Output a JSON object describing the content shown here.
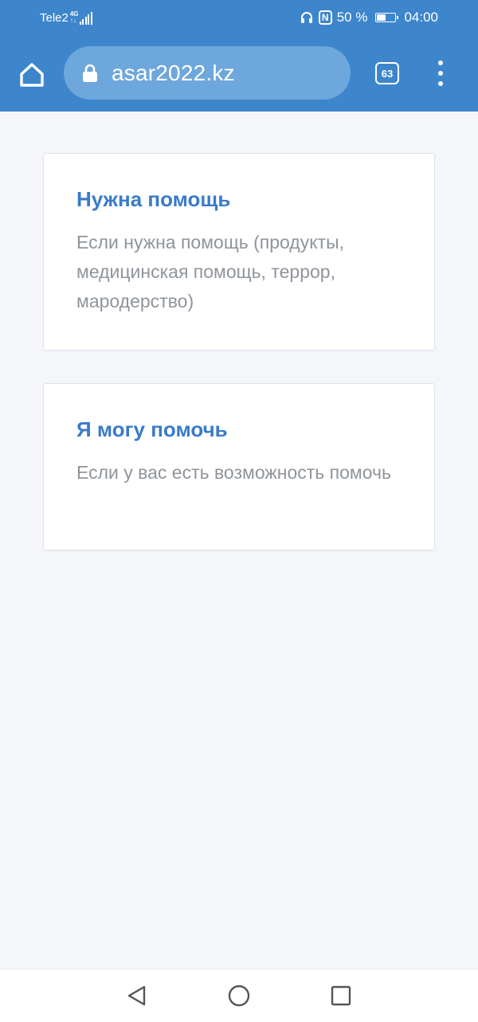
{
  "status_bar": {
    "carrier": "Tele2",
    "network_type": "4G",
    "nfc_label": "N",
    "battery_percent": "50 %",
    "battery_level": 0.5,
    "time": "04:00"
  },
  "browser": {
    "url": "asar2022.kz",
    "tab_count": "63",
    "icons": {
      "home": "home-icon",
      "lock": "lock-icon",
      "menu": "more-vertical-icon"
    }
  },
  "cards": [
    {
      "title": "Нужна помощь",
      "description": "Если нужна помощь (продукты, медицинская помощь, террор, мародерство)"
    },
    {
      "title": "Я могу помочь",
      "description": "Если у вас есть возможность помочь"
    }
  ],
  "nav_bar": {
    "icons": [
      "back-icon",
      "home-circle-icon",
      "recent-apps-icon"
    ]
  },
  "colors": {
    "chrome": "#3d86cc",
    "url_bar": "#6ea7dc",
    "card_title": "#3a7bc8",
    "card_text": "#8f949b",
    "background": "#f4f6fa"
  }
}
